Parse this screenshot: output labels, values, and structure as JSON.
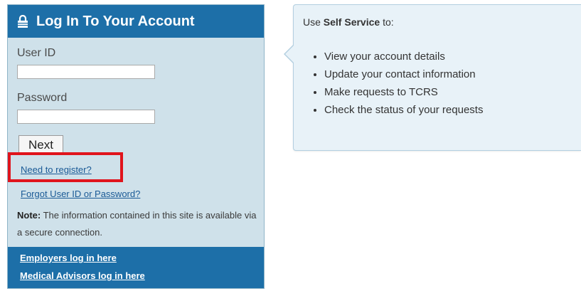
{
  "login": {
    "title": "Log In To Your Account",
    "user_id_label": "User ID",
    "user_id_value": "",
    "password_label": "Password",
    "password_value": "",
    "next_label": "Next",
    "register_link": "Need to register?",
    "forgot_link": "Forgot User ID or Password?",
    "note_label": "Note:",
    "note_text": " The information contained in this site is available via a secure connection."
  },
  "footer": {
    "employers_link": "Employers log in here",
    "medical_link": "Medical Advisors log in here"
  },
  "info": {
    "intro_prefix": "Use ",
    "intro_bold": "Self Service",
    "intro_suffix": " to:",
    "items": [
      "View your account details",
      "Update your contact information",
      "Make requests to TCRS",
      "Check the status of your requests"
    ]
  },
  "icons": {
    "lock": "lock-icon"
  },
  "colors": {
    "header_blue": "#1d6fa8",
    "panel_bg": "#cfe1ea",
    "info_bg": "#e8f2f8",
    "highlight_red": "#e0141c",
    "link_blue": "#1a5a96"
  }
}
